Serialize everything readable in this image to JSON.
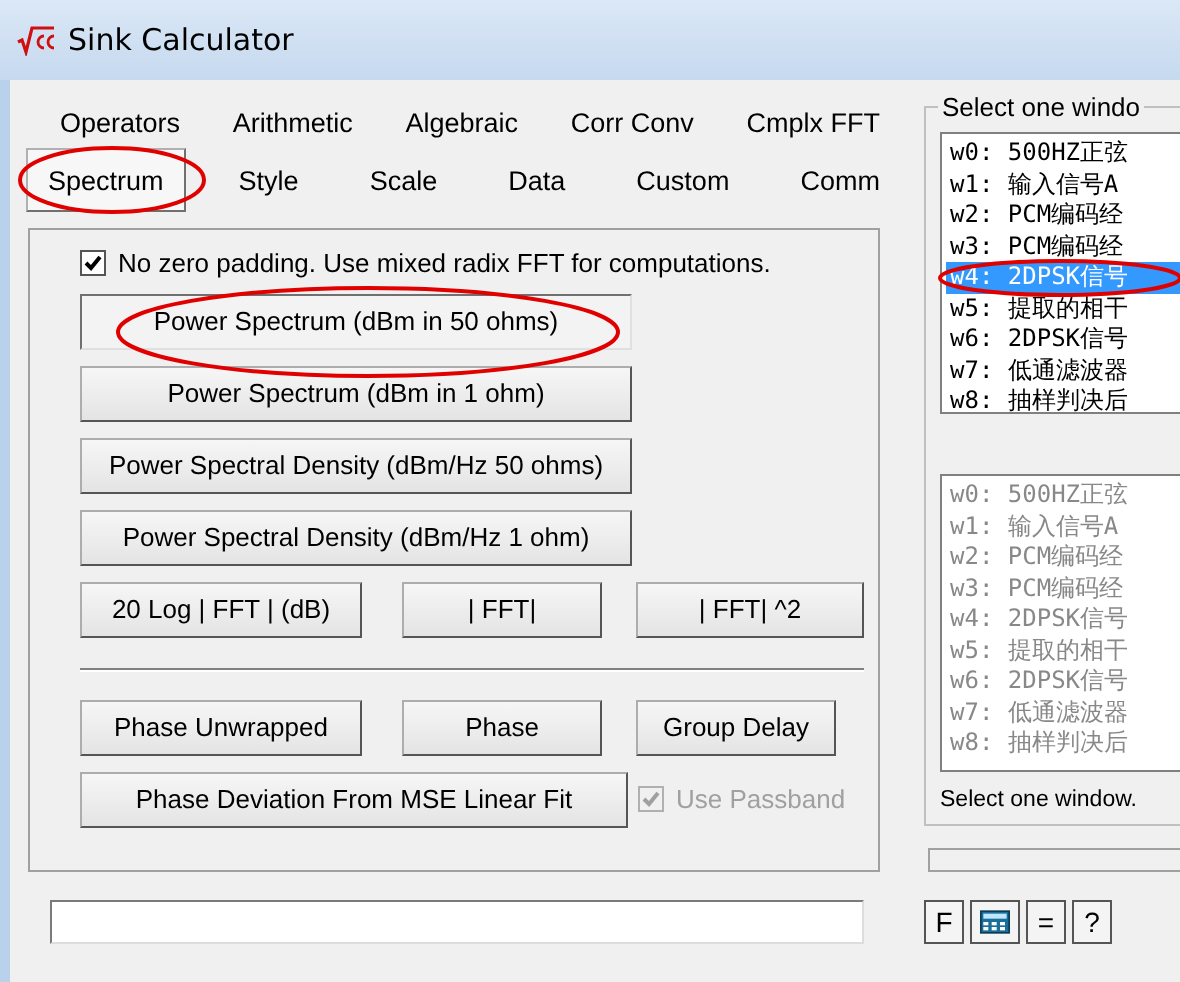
{
  "window": {
    "title": "Sink Calculator"
  },
  "tab_rows": [
    {
      "tabs": [
        {
          "label": "Operators",
          "selected": false
        },
        {
          "label": "Arithmetic",
          "selected": false
        },
        {
          "label": "Algebraic",
          "selected": false
        },
        {
          "label": "Corr Conv",
          "selected": false
        },
        {
          "label": "Cmplx FFT",
          "selected": false
        }
      ]
    },
    {
      "tabs": [
        {
          "label": "Spectrum",
          "selected": true
        },
        {
          "label": "Style",
          "selected": false
        },
        {
          "label": "Scale",
          "selected": false
        },
        {
          "label": "Data",
          "selected": false
        },
        {
          "label": "Custom",
          "selected": false
        },
        {
          "label": "Comm",
          "selected": false
        }
      ]
    }
  ],
  "panel": {
    "option": {
      "label": "No zero padding. Use mixed radix FFT for computations.",
      "checked": true
    },
    "spectrum_rows": [
      {
        "items": [
          {
            "kind": "button",
            "label": "Power Spectrum (dBm in 50 ohms)",
            "selected": true
          }
        ]
      },
      {
        "items": [
          {
            "kind": "button",
            "label": "Power Spectrum (dBm in 1 ohm)",
            "selected": false
          }
        ]
      },
      {
        "items": [
          {
            "kind": "button",
            "label": "Power Spectral Density (dBm/Hz 50 ohms)",
            "selected": false
          }
        ]
      },
      {
        "items": [
          {
            "kind": "button",
            "label": "Power Spectral Density (dBm/Hz 1 ohm)",
            "selected": false
          }
        ]
      },
      {
        "items": [
          {
            "kind": "button",
            "label": "20 Log | FFT |   (dB)",
            "selected": false
          },
          {
            "kind": "button",
            "label": "| FFT|",
            "selected": false
          },
          {
            "kind": "button",
            "label": "| FFT| ^2",
            "selected": false
          }
        ]
      }
    ],
    "phase_rows": [
      {
        "items": [
          {
            "kind": "button",
            "label": "Phase Unwrapped",
            "selected": false
          },
          {
            "kind": "button",
            "label": "Phase",
            "selected": false
          },
          {
            "kind": "button",
            "label": "Group Delay",
            "selected": false
          }
        ]
      },
      {
        "items": [
          {
            "kind": "button",
            "label": "Phase Deviation From MSE Linear Fit",
            "selected": false
          },
          {
            "kind": "checkbox",
            "label": "Use Passband",
            "checked": true,
            "disabled": true
          }
        ]
      }
    ]
  },
  "window_select": {
    "title": "Select one windo",
    "lists": [
      {
        "disabled": false,
        "items": [
          {
            "id": "w0:",
            "text": "500HZ正弦",
            "selected": false
          },
          {
            "id": "w1:",
            "text": "输入信号A",
            "selected": false
          },
          {
            "id": "w2:",
            "text": "PCM编码经",
            "selected": false
          },
          {
            "id": "w3:",
            "text": "PCM编码经",
            "selected": false
          },
          {
            "id": "w4:",
            "text": "2DPSK信号",
            "selected": true
          },
          {
            "id": "w5:",
            "text": "提取的相干",
            "selected": false
          },
          {
            "id": "w6:",
            "text": "2DPSK信号",
            "selected": false
          },
          {
            "id": "w7:",
            "text": "低通滤波器",
            "selected": false
          },
          {
            "id": "w8:",
            "text": "抽样判决后",
            "selected": false
          }
        ]
      },
      {
        "disabled": true,
        "items": [
          {
            "id": "w0:",
            "text": "500HZ正弦",
            "selected": false
          },
          {
            "id": "w1:",
            "text": "输入信号A",
            "selected": false
          },
          {
            "id": "w2:",
            "text": "PCM编码经",
            "selected": false
          },
          {
            "id": "w3:",
            "text": "PCM编码经",
            "selected": false
          },
          {
            "id": "w4:",
            "text": "2DPSK信号",
            "selected": false
          },
          {
            "id": "w5:",
            "text": "提取的相干",
            "selected": false
          },
          {
            "id": "w6:",
            "text": "2DPSK信号",
            "selected": false
          },
          {
            "id": "w7:",
            "text": "低通滤波器",
            "selected": false
          },
          {
            "id": "w8:",
            "text": "抽样判决后",
            "selected": false
          }
        ]
      }
    ],
    "hint": "Select one window."
  },
  "bottom": {
    "buttons": [
      {
        "kind": "text",
        "label": "F"
      },
      {
        "kind": "calculator"
      },
      {
        "kind": "text",
        "label": "="
      },
      {
        "kind": "text",
        "label": "?"
      }
    ]
  }
}
